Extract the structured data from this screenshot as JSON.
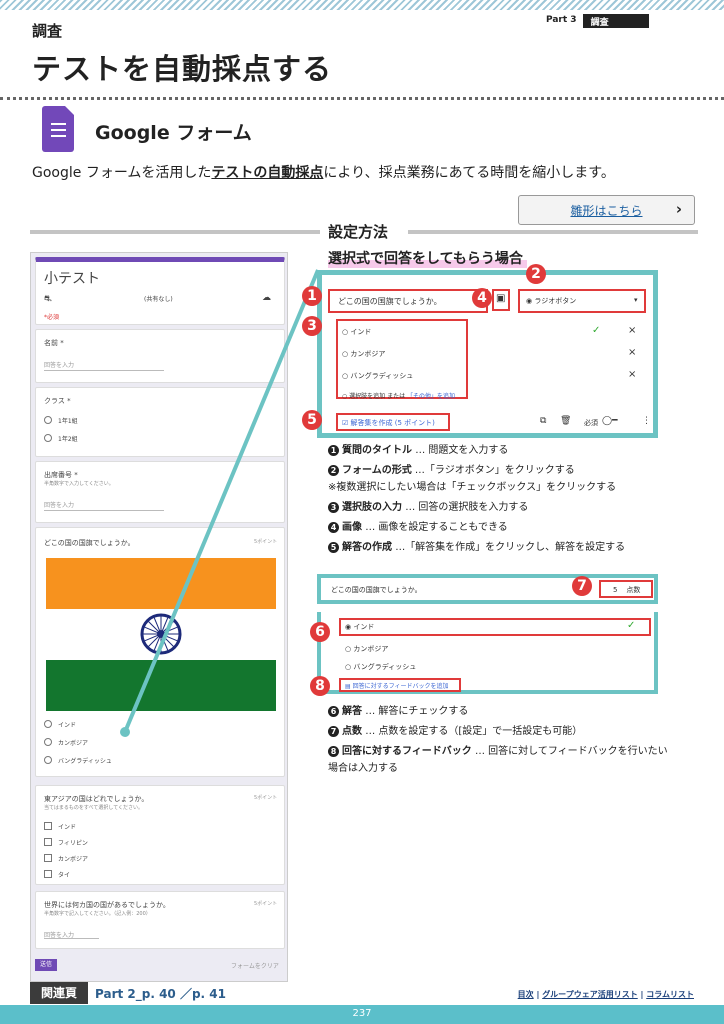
{
  "header": {
    "part": "Part 3",
    "section": "調査",
    "category": "調査",
    "title": "テストを自動採点する"
  },
  "app": {
    "name": "Google フォーム",
    "icon": "google-forms-icon"
  },
  "intro": {
    "prefix": "Google フォームを活用した",
    "highlight": "テストの自動採点",
    "suffix": "により、採点業務にあてる時間を縮小します。"
  },
  "template_button": {
    "label": "雛形はこちら",
    "icon": "chevron-right-icon"
  },
  "method": {
    "title": "設定方法",
    "case": "選択式で回答をしてもらう場合"
  },
  "form_preview": {
    "title": "小テスト",
    "account_note": "(共有なし)",
    "required_note": "*必須",
    "q_name": "名前 *",
    "name_ph": "回答を入力",
    "q_class": "クラス *",
    "class_opts": [
      "1年1組",
      "1年2組"
    ],
    "q_number": "出席番号 *",
    "number_hint": "半角数字で入力してください。",
    "number_ph": "回答を入力",
    "q_flag": "どこの国の国旗でしょうか。",
    "flag_pts": "5ポイント",
    "flag_opts": [
      "インド",
      "カンボジア",
      "バングラディッシュ"
    ],
    "q_asia": "東アジアの国はどれでしょうか。",
    "asia_hint": "当てはまるものをすべて選択してください。",
    "asia_pts": "5ポイント",
    "asia_opts": [
      "インド",
      "フィリピン",
      "カンボジア",
      "タイ"
    ],
    "q_world": "世界には何カ国の国があるでしょうか。",
    "world_hint": "半角数字で記入してください。（記入例：200）",
    "world_pts": "5ポイント",
    "world_ph": "回答を入力",
    "submit": "送信",
    "clear": "フォームをクリア"
  },
  "editor": {
    "question": "どこの国の国旗でしょうか。",
    "type": "ラジオボタン",
    "options": [
      "インド",
      "カンボジア",
      "バングラディッシュ"
    ],
    "add_option": "選択肢を追加",
    "or": "または",
    "add_other": "「その他」を追加",
    "answer_key": "解答集を作成",
    "answer_pts": "(5 ポイント)",
    "required": "必須"
  },
  "steps1": [
    {
      "n": "1",
      "title": "質問のタイトル",
      "body": "… 問題文を入力する"
    },
    {
      "n": "2",
      "title": "フォームの形式",
      "body": "…「ラジオボタン」をクリックする"
    },
    {
      "n": "",
      "title": "",
      "body": "※複数選択にしたい場合は「チェックボックス」をクリックする"
    },
    {
      "n": "3",
      "title": "選択肢の入力",
      "body": "… 回答の選択肢を入力する"
    },
    {
      "n": "4",
      "title": "画像",
      "body": "… 画像を設定することもできる"
    },
    {
      "n": "5",
      "title": "解答の作成",
      "body": "…「解答集を作成」をクリックし、解答を設定する"
    }
  ],
  "answer_panel": {
    "question": "どこの国の国旗でしょうか。",
    "points": "5",
    "points_label": "点数",
    "options": [
      "インド",
      "カンボジア",
      "バングラディッシュ"
    ],
    "feedback": "回答に対するフィードバックを追加"
  },
  "steps2": [
    {
      "n": "6",
      "title": "解答",
      "body": "… 解答にチェックする"
    },
    {
      "n": "7",
      "title": "点数",
      "body": "… 点数を設定する（[設定」で一括設定も可能）"
    },
    {
      "n": "8",
      "title": "回答に対するフィードバック",
      "body": "… 回答に対してフィードバックを行いたい"
    },
    {
      "n": "",
      "title": "",
      "body": "場合は入力する"
    }
  ],
  "footer": {
    "related_label": "関連頁",
    "related_refs": "Part 2_p. 40 ／p. 41",
    "links": [
      "目次",
      "グループウェア活用リスト",
      "コラムリスト"
    ],
    "separator": "|",
    "page": "237"
  },
  "colors": {
    "accent": "#6cc3c3",
    "marker": "#e03a3a",
    "forms": "#7248b9"
  }
}
